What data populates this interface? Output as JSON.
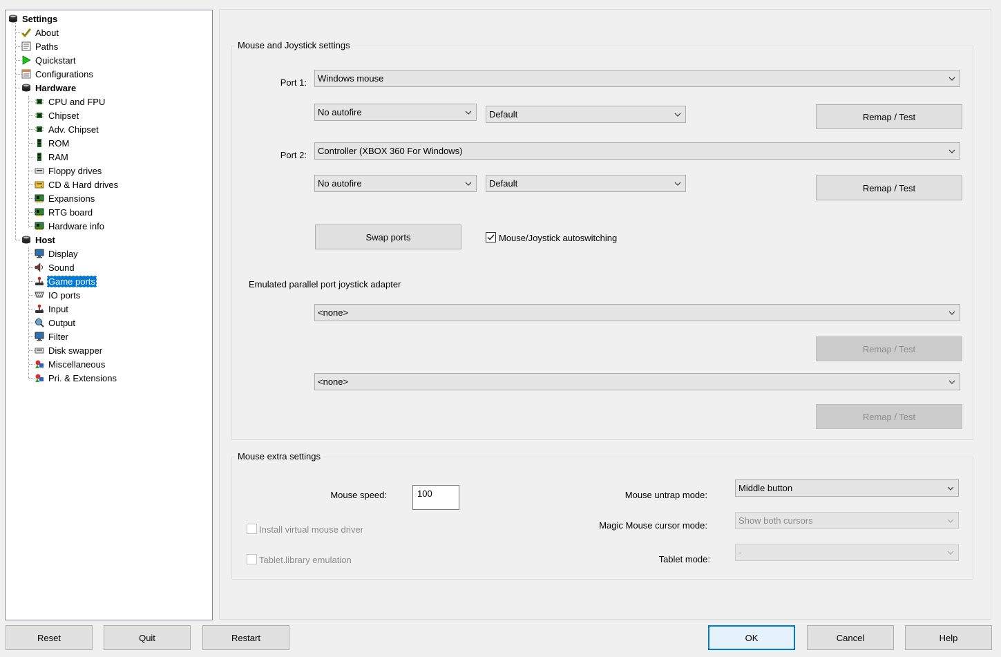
{
  "tree": {
    "root": "Settings",
    "items": [
      {
        "label": "About",
        "icon": "checkmark-icon"
      },
      {
        "label": "Paths",
        "icon": "folder-list-icon"
      },
      {
        "label": "Quickstart",
        "icon": "play-icon"
      },
      {
        "label": "Configurations",
        "icon": "config-list-icon"
      },
      {
        "label": "Hardware",
        "icon": "disk-stack-icon"
      },
      {
        "label": "CPU and FPU",
        "icon": "chip-icon"
      },
      {
        "label": "Chipset",
        "icon": "chip-icon"
      },
      {
        "label": "Adv. Chipset",
        "icon": "chip-icon"
      },
      {
        "label": "ROM",
        "icon": "memory-icon"
      },
      {
        "label": "RAM",
        "icon": "memory-icon"
      },
      {
        "label": "Floppy drives",
        "icon": "floppy-drive-icon"
      },
      {
        "label": "CD & Hard drives",
        "icon": "hard-drive-icon"
      },
      {
        "label": "Expansions",
        "icon": "expansion-card-icon"
      },
      {
        "label": "RTG board",
        "icon": "expansion-card-icon"
      },
      {
        "label": "Hardware info",
        "icon": "expansion-card-icon"
      },
      {
        "label": "Host",
        "icon": "disk-stack-icon"
      },
      {
        "label": "Display",
        "icon": "monitor-icon"
      },
      {
        "label": "Sound",
        "icon": "speaker-icon"
      },
      {
        "label": "Game ports",
        "icon": "joystick-icon"
      },
      {
        "label": "IO ports",
        "icon": "io-port-icon"
      },
      {
        "label": "Input",
        "icon": "joystick-icon"
      },
      {
        "label": "Output",
        "icon": "output-icon"
      },
      {
        "label": "Filter",
        "icon": "monitor-icon"
      },
      {
        "label": "Disk swapper",
        "icon": "floppy-drive-icon"
      },
      {
        "label": "Miscellaneous",
        "icon": "shapes-icon"
      },
      {
        "label": "Pri. & Extensions",
        "icon": "shapes-icon"
      }
    ]
  },
  "joystick_group": {
    "title": "Mouse and Joystick settings",
    "port1_label": "Port 1:",
    "port1_device": "Windows mouse",
    "port1_autofire": "No autofire",
    "port1_mode": "Default",
    "port1_remap": "Remap / Test",
    "port2_label": "Port 2:",
    "port2_device": "Controller (XBOX 360 For Windows)",
    "port2_autofire": "No autofire",
    "port2_mode": "Default",
    "port2_remap": "Remap / Test",
    "swap_ports": "Swap ports",
    "autoswitch_label": "Mouse/Joystick autoswitching",
    "autoswitch_checked": true,
    "parallel_title": "Emulated parallel port joystick adapter",
    "parallel1_device": "<none>",
    "parallel1_remap": "Remap / Test",
    "parallel2_device": "<none>",
    "parallel2_remap": "Remap / Test"
  },
  "mouse_group": {
    "title": "Mouse extra settings",
    "speed_label": "Mouse speed:",
    "speed_value": "100",
    "virtual_driver_label": "Install virtual mouse driver",
    "tablet_lib_label": "Tablet.library emulation",
    "untrap_label": "Mouse untrap mode:",
    "untrap_value": "Middle button",
    "magic_label": "Magic Mouse cursor mode:",
    "magic_value": "Show both cursors",
    "tablet_mode_label": "Tablet mode:",
    "tablet_mode_value": "-"
  },
  "footer": {
    "reset": "Reset",
    "quit": "Quit",
    "restart": "Restart",
    "ok": "OK",
    "cancel": "Cancel",
    "help": "Help"
  },
  "colors": {
    "selection": "#0078d7",
    "window_bg": "#f0f0f0",
    "button_bg": "#e1e1e1"
  }
}
